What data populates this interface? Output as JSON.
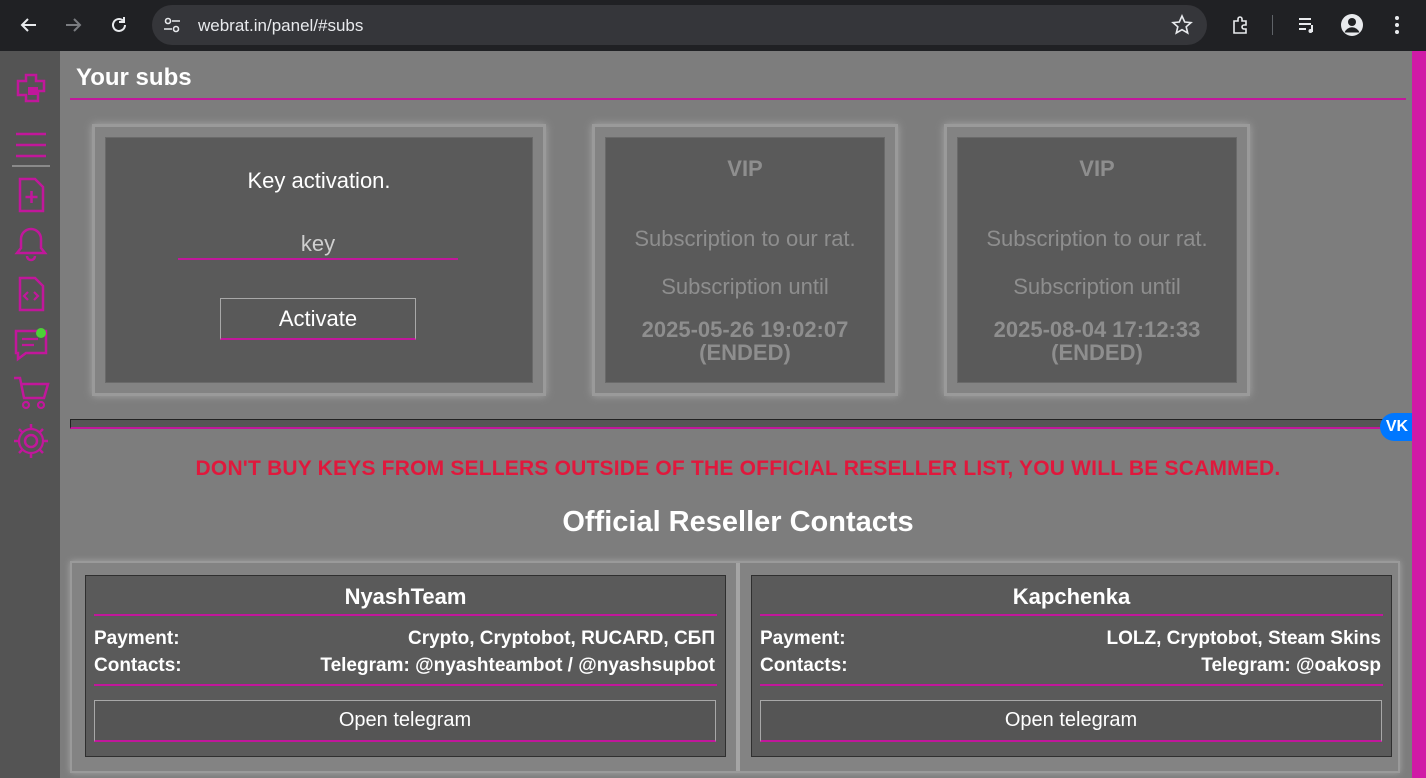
{
  "browser": {
    "url": "webrat.in/panel/#subs"
  },
  "page": {
    "title": "Your subs"
  },
  "activation": {
    "title": "Key activation.",
    "placeholder": "key",
    "button": "Activate"
  },
  "subs": [
    {
      "title": "VIP",
      "description": "Subscription to our rat.",
      "until_label": "Subscription until",
      "date": "2025-05-26 19:02:07",
      "status": "(ENDED)"
    },
    {
      "title": "VIP",
      "description": "Subscription to our rat.",
      "until_label": "Subscription until",
      "date": "2025-08-04 17:12:33",
      "status": "(ENDED)"
    }
  ],
  "vk_badge": "VK",
  "warning": "DON'T BUY KEYS FROM SELLERS OUTSIDE OF THE OFFICIAL RESELLER LIST, YOU WILL BE SCAMMED.",
  "resellers_title": "Official Reseller Contacts",
  "resellers": [
    {
      "name": "NyashTeam",
      "payment_label": "Payment:",
      "payment": "Crypto, Cryptobot, RUCARD, СБП",
      "contacts_label": "Contacts:",
      "contacts": "Telegram: @nyashteambot / @nyashsupbot",
      "button": "Open telegram"
    },
    {
      "name": "Kapchenka",
      "payment_label": "Payment:",
      "payment": "LOLZ, Cryptobot, Steam Skins",
      "contacts_label": "Contacts:",
      "contacts": "Telegram: @oakosp",
      "button": "Open telegram"
    }
  ],
  "colors": {
    "accent": "#c1179b",
    "warning": "#e0183c",
    "online": "#4cd137"
  },
  "sidebar_icons": [
    "logo-icon",
    "menu-icon",
    "file-add-icon",
    "bell-icon",
    "file-code-icon",
    "chat-icon",
    "cart-icon",
    "gear-icon"
  ]
}
